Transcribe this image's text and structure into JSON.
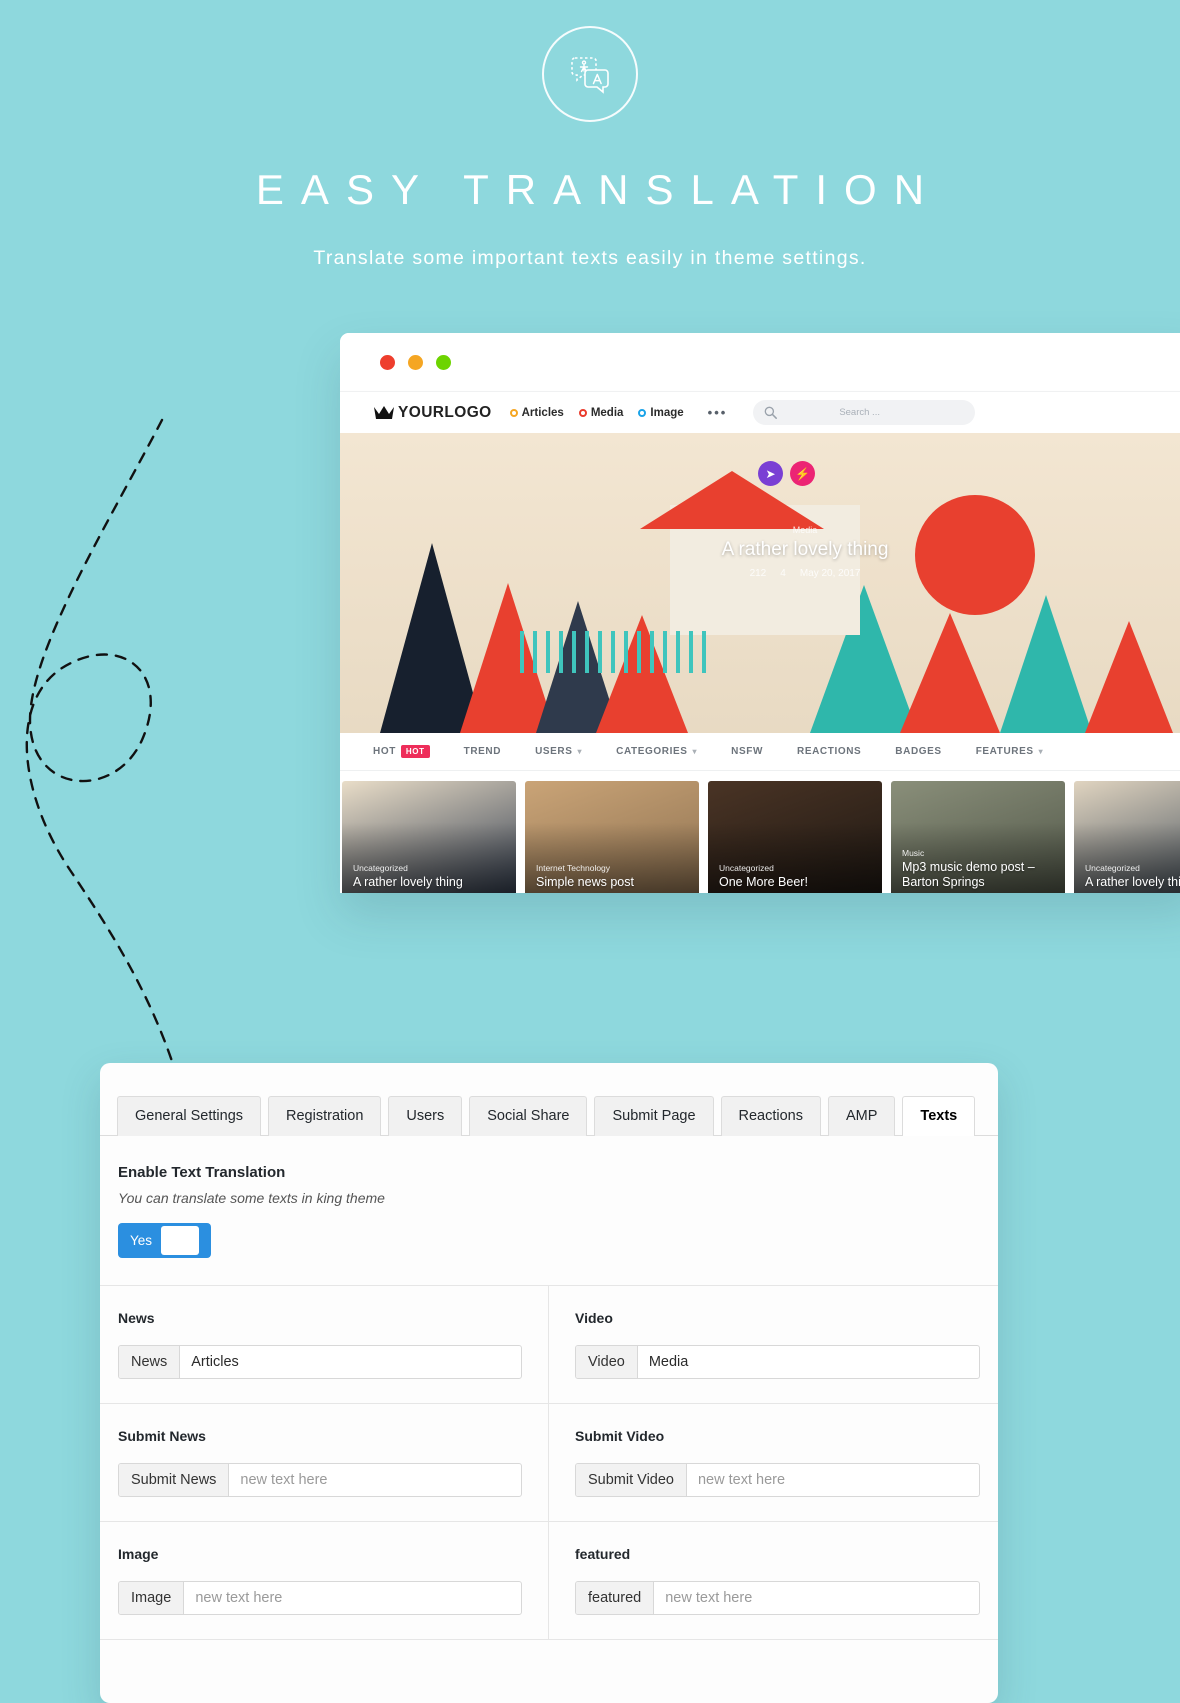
{
  "hero": {
    "icon": "translate-icon",
    "title": "EASY TRANSLATION",
    "subtitle": "Translate some important texts easily in theme settings."
  },
  "colors": {
    "background": "#8ed8dd",
    "toggle_on": "#2b8fe0",
    "hot_badge": "#ee2d5a",
    "traffic_red": "#ee3e2d",
    "traffic_yellow": "#f5a623",
    "traffic_green": "#6dd400"
  },
  "browser": {
    "traffic_lights": [
      "red",
      "yellow",
      "green"
    ],
    "logo": "YOURLOGO",
    "nav_links": [
      {
        "label": "Articles",
        "dot": "yellow"
      },
      {
        "label": "Media",
        "dot": "red"
      },
      {
        "label": "Image",
        "dot": "blue"
      }
    ],
    "nav_more": "•••",
    "search_placeholder": "Search ...",
    "hero_post": {
      "category": "Media",
      "title": "A rather lovely thing",
      "views": "212",
      "comments": "4",
      "date": "May 20, 2017"
    },
    "subnav": [
      {
        "label": "HOT",
        "badge": "HOT",
        "caret": false
      },
      {
        "label": "TREND",
        "badge": "",
        "caret": false
      },
      {
        "label": "USERS",
        "badge": "",
        "caret": true
      },
      {
        "label": "CATEGORIES",
        "badge": "",
        "caret": true
      },
      {
        "label": "NSFW",
        "badge": "",
        "caret": false
      },
      {
        "label": "REACTIONS",
        "badge": "",
        "caret": false
      },
      {
        "label": "BADGES",
        "badge": "",
        "caret": false
      },
      {
        "label": "FEATURES",
        "badge": "",
        "caret": true
      }
    ],
    "cards": [
      {
        "category": "Uncategorized",
        "title": "A rather lovely thing"
      },
      {
        "category": "Internet Technology",
        "title": "Simple news post"
      },
      {
        "category": "Uncategorized",
        "title": "One More Beer!"
      },
      {
        "category": "Music",
        "title": "Mp3 music demo post – Barton Springs"
      },
      {
        "category": "Uncategorized",
        "title": "A rather lovely thing"
      }
    ]
  },
  "settings": {
    "tabs": [
      {
        "label": "General Settings",
        "active": false
      },
      {
        "label": "Registration",
        "active": false
      },
      {
        "label": "Users",
        "active": false
      },
      {
        "label": "Social Share",
        "active": false
      },
      {
        "label": "Submit Page",
        "active": false
      },
      {
        "label": "Reactions",
        "active": false
      },
      {
        "label": "AMP",
        "active": false
      },
      {
        "label": "Texts",
        "active": true
      }
    ],
    "enable": {
      "title": "Enable Text Translation",
      "description": "You can translate some texts in king theme",
      "toggle_label": "Yes"
    },
    "fields": [
      {
        "title": "News",
        "addon": "News",
        "value": "Articles",
        "placeholder": ""
      },
      {
        "title": "Video",
        "addon": "Video",
        "value": "Media",
        "placeholder": ""
      },
      {
        "title": "Submit News",
        "addon": "Submit News",
        "value": "",
        "placeholder": "new text here"
      },
      {
        "title": "Submit Video",
        "addon": "Submit Video",
        "value": "",
        "placeholder": "new text here"
      },
      {
        "title": "Image",
        "addon": "Image",
        "value": "",
        "placeholder": "new text here"
      },
      {
        "title": "featured",
        "addon": "featured",
        "value": "",
        "placeholder": "new text here"
      }
    ]
  }
}
